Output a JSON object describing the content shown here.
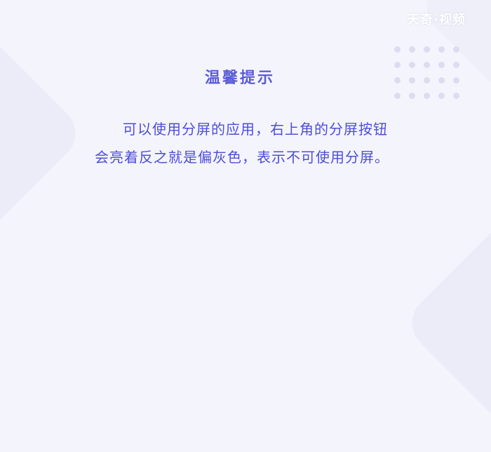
{
  "watermark": {
    "text": "天奇·视频"
  },
  "main": {
    "title": "温馨提示",
    "line1": "可以使用分屏的应用，右上角的分屏按钮",
    "line2": "会亮着反之就是偏灰色，表示不可使用分屏。"
  },
  "colors": {
    "background": "#f4f4fc",
    "accent": "#5b5cd6",
    "text": "#4d4ed7",
    "dot": "#dcdcf1"
  }
}
